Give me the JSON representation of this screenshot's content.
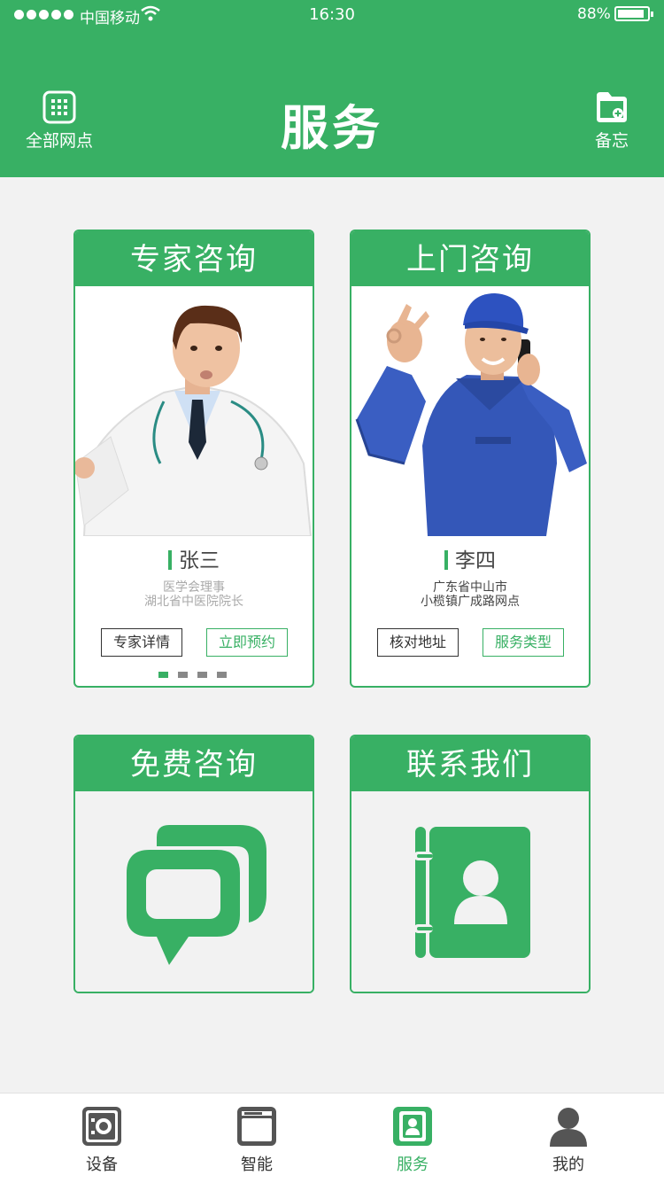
{
  "status": {
    "carrier": "中国移动",
    "time": "16:30",
    "battery": "88%"
  },
  "header": {
    "title": "服务",
    "left_label": "全部网点",
    "right_label": "备忘"
  },
  "cards": {
    "expert": {
      "title": "专家咨询",
      "name": "张三",
      "desc_line1": "医学会理事",
      "desc_line2": "湖北省中医院院长",
      "btn1": "专家详情",
      "btn2": "立即预约"
    },
    "onsite": {
      "title": "上门咨询",
      "name": "李四",
      "desc_line1": "广东省中山市",
      "desc_line2": "小榄镇广成路网点",
      "btn1": "核对地址",
      "btn2": "服务类型"
    },
    "free": {
      "title": "免费咨询"
    },
    "contact": {
      "title": "联系我们"
    }
  },
  "tabs": [
    {
      "label": "设备",
      "icon": "safe-icon"
    },
    {
      "label": "智能",
      "icon": "window-icon"
    },
    {
      "label": "服务",
      "icon": "service-icon",
      "active": true
    },
    {
      "label": "我的",
      "icon": "user-icon"
    }
  ],
  "colors": {
    "accent": "#38b064",
    "background": "#f2f2f2"
  }
}
